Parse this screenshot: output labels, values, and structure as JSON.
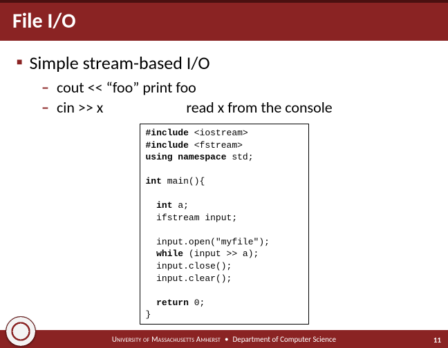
{
  "title": "File I/O",
  "main_bullet": "Simple stream-based I/O",
  "sub_items": [
    {
      "left": "cout << “foo” print foo",
      "right": ""
    },
    {
      "left": "cin >> x",
      "right": "read x from the console"
    }
  ],
  "code": {
    "l1a": "#include",
    "l1b": " <iostream>",
    "l2a": "#include",
    "l2b": " <fstream>",
    "l3a": "using namespace",
    "l3b": " std;",
    "blank1": "",
    "l4a": "int",
    "l4b": " main(){",
    "blank2": "",
    "l5a": "  int",
    "l5b": " a;",
    "l6": "  ifstream input;",
    "blank3": "",
    "l7": "  input.open(\"myfile\");",
    "l8a": "  while",
    "l8b": " (input >> a);",
    "l9": "  input.close();",
    "l10": "  input.clear();",
    "blank4": "",
    "l11a": "  return",
    "l11b": " 0;",
    "l12": "}"
  },
  "footer": {
    "university": "University of Massachusetts Amherst",
    "separator": "•",
    "department": "Department of Computer Science"
  },
  "page_number": "11"
}
